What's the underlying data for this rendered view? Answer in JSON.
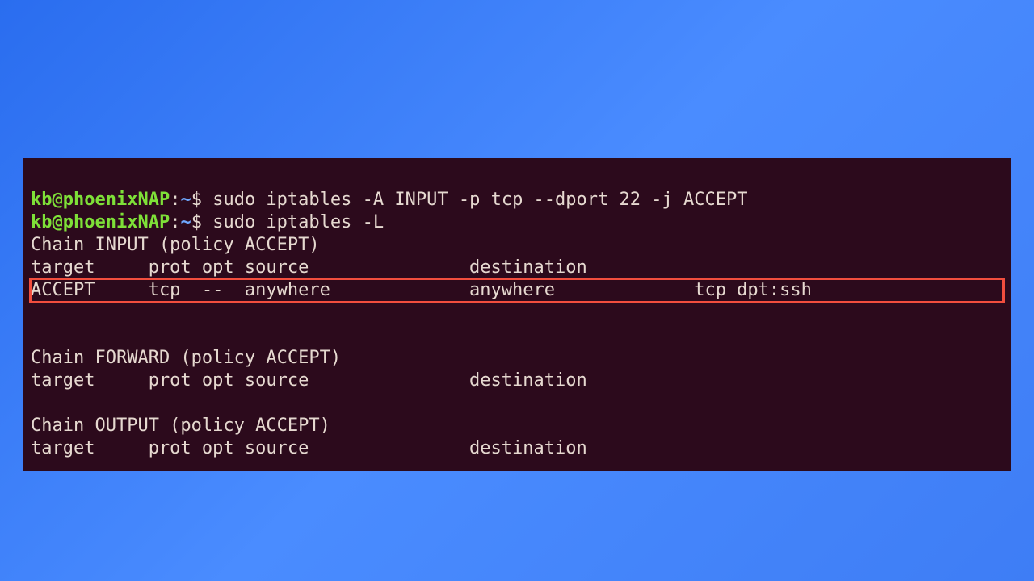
{
  "prompt": {
    "user": "kb",
    "at": "@",
    "host": "phoenixNAP",
    "colon": ":",
    "path": "~",
    "dollar": "$"
  },
  "commands": [
    "sudo iptables -A INPUT -p tcp --dport 22 -j ACCEPT",
    "sudo iptables -L"
  ],
  "output": {
    "chain_input_header": "Chain INPUT (policy ACCEPT)",
    "columns_header": "target     prot opt source               destination",
    "input_rule_row": "ACCEPT     tcp  --  anywhere             anywhere             tcp dpt:ssh",
    "blank": "",
    "chain_forward_header": "Chain FORWARD (policy ACCEPT)",
    "forward_columns": "target     prot opt source               destination",
    "chain_output_header": "Chain OUTPUT (policy ACCEPT)",
    "output_columns": "target     prot opt source               destination"
  }
}
